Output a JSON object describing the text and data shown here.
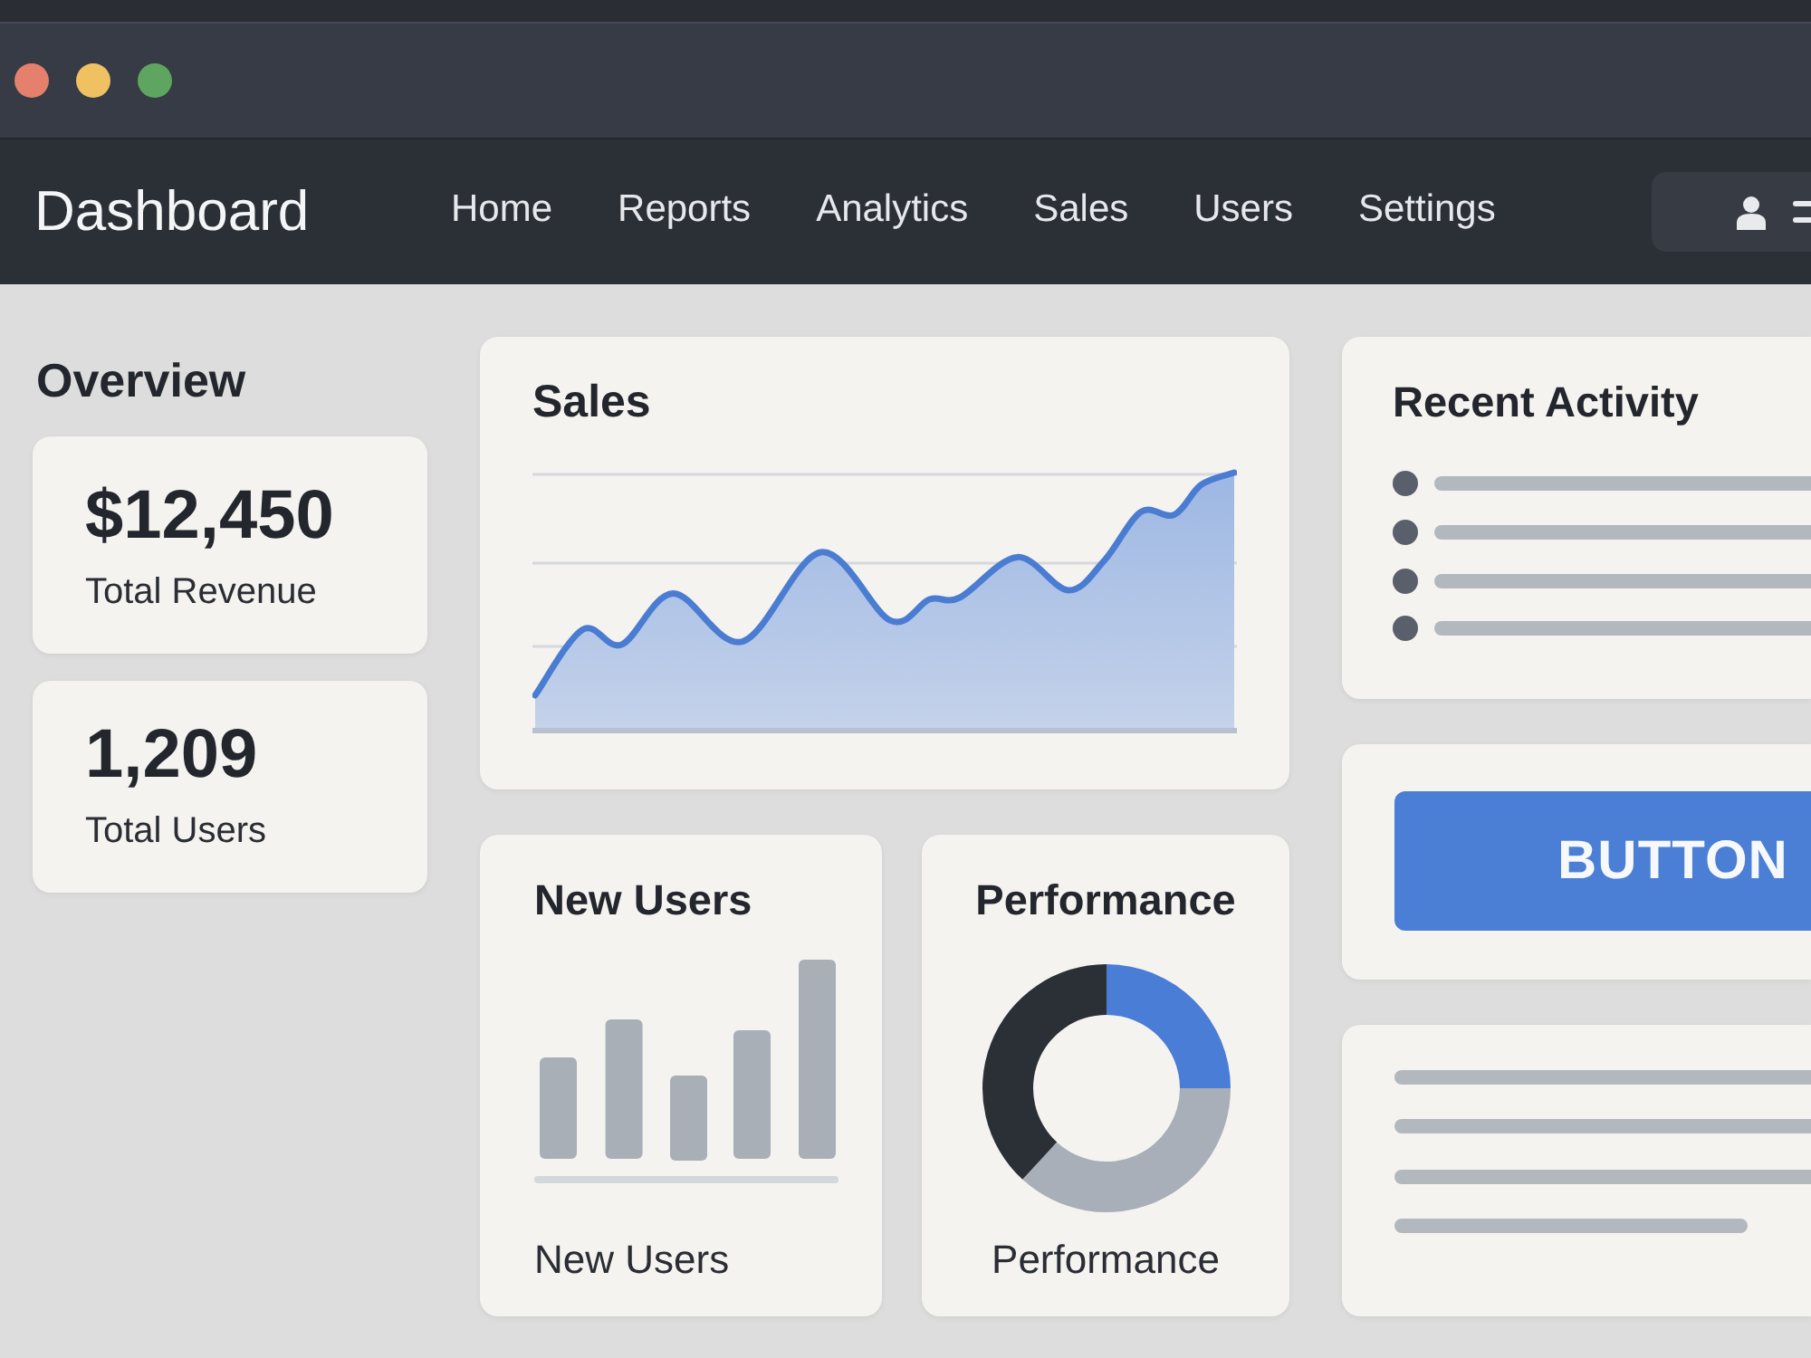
{
  "window": {
    "controls": [
      {
        "color": "#e5806c"
      },
      {
        "color": "#f0c163"
      },
      {
        "color": "#5ea65f"
      }
    ]
  },
  "navbar": {
    "brand": "Dashboard",
    "links": [
      {
        "label": "Home",
        "selected": false
      },
      {
        "label": "Reports",
        "selected": false
      },
      {
        "label": "Analytics",
        "selected": false
      },
      {
        "label": "Sales",
        "selected": false
      },
      {
        "label": "Users",
        "selected": false
      },
      {
        "label": "Settings",
        "selected": false
      }
    ]
  },
  "overview": {
    "title": "Overview",
    "stats": [
      {
        "value": "$12,450",
        "label": "Total Revenue"
      },
      {
        "value": "1,209",
        "label": "Total Users"
      }
    ]
  },
  "sales": {
    "title": "Sales"
  },
  "new_users": {
    "title": "New Users",
    "caption": "New Users"
  },
  "performance": {
    "title": "Performance",
    "caption": "Performance"
  },
  "recent_activity": {
    "title": "Recent Activity"
  },
  "action_button": {
    "label": "BUTTON"
  }
}
